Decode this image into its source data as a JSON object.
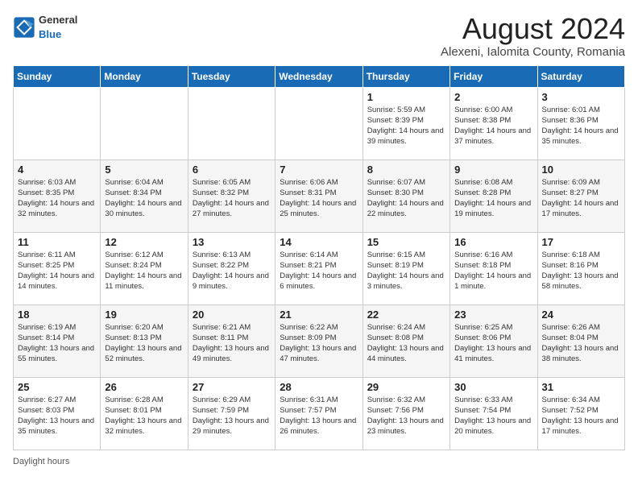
{
  "logo": {
    "general": "General",
    "blue": "Blue"
  },
  "title": {
    "month_year": "August 2024",
    "location": "Alexeni, Ialomita County, Romania"
  },
  "days_of_week": [
    "Sunday",
    "Monday",
    "Tuesday",
    "Wednesday",
    "Thursday",
    "Friday",
    "Saturday"
  ],
  "weeks": [
    [
      {
        "day": "",
        "info": ""
      },
      {
        "day": "",
        "info": ""
      },
      {
        "day": "",
        "info": ""
      },
      {
        "day": "",
        "info": ""
      },
      {
        "day": "1",
        "info": "Sunrise: 5:59 AM\nSunset: 8:39 PM\nDaylight: 14 hours and 39 minutes."
      },
      {
        "day": "2",
        "info": "Sunrise: 6:00 AM\nSunset: 8:38 PM\nDaylight: 14 hours and 37 minutes."
      },
      {
        "day": "3",
        "info": "Sunrise: 6:01 AM\nSunset: 8:36 PM\nDaylight: 14 hours and 35 minutes."
      }
    ],
    [
      {
        "day": "4",
        "info": "Sunrise: 6:03 AM\nSunset: 8:35 PM\nDaylight: 14 hours and 32 minutes."
      },
      {
        "day": "5",
        "info": "Sunrise: 6:04 AM\nSunset: 8:34 PM\nDaylight: 14 hours and 30 minutes."
      },
      {
        "day": "6",
        "info": "Sunrise: 6:05 AM\nSunset: 8:32 PM\nDaylight: 14 hours and 27 minutes."
      },
      {
        "day": "7",
        "info": "Sunrise: 6:06 AM\nSunset: 8:31 PM\nDaylight: 14 hours and 25 minutes."
      },
      {
        "day": "8",
        "info": "Sunrise: 6:07 AM\nSunset: 8:30 PM\nDaylight: 14 hours and 22 minutes."
      },
      {
        "day": "9",
        "info": "Sunrise: 6:08 AM\nSunset: 8:28 PM\nDaylight: 14 hours and 19 minutes."
      },
      {
        "day": "10",
        "info": "Sunrise: 6:09 AM\nSunset: 8:27 PM\nDaylight: 14 hours and 17 minutes."
      }
    ],
    [
      {
        "day": "11",
        "info": "Sunrise: 6:11 AM\nSunset: 8:25 PM\nDaylight: 14 hours and 14 minutes."
      },
      {
        "day": "12",
        "info": "Sunrise: 6:12 AM\nSunset: 8:24 PM\nDaylight: 14 hours and 11 minutes."
      },
      {
        "day": "13",
        "info": "Sunrise: 6:13 AM\nSunset: 8:22 PM\nDaylight: 14 hours and 9 minutes."
      },
      {
        "day": "14",
        "info": "Sunrise: 6:14 AM\nSunset: 8:21 PM\nDaylight: 14 hours and 6 minutes."
      },
      {
        "day": "15",
        "info": "Sunrise: 6:15 AM\nSunset: 8:19 PM\nDaylight: 14 hours and 3 minutes."
      },
      {
        "day": "16",
        "info": "Sunrise: 6:16 AM\nSunset: 8:18 PM\nDaylight: 14 hours and 1 minute."
      },
      {
        "day": "17",
        "info": "Sunrise: 6:18 AM\nSunset: 8:16 PM\nDaylight: 13 hours and 58 minutes."
      }
    ],
    [
      {
        "day": "18",
        "info": "Sunrise: 6:19 AM\nSunset: 8:14 PM\nDaylight: 13 hours and 55 minutes."
      },
      {
        "day": "19",
        "info": "Sunrise: 6:20 AM\nSunset: 8:13 PM\nDaylight: 13 hours and 52 minutes."
      },
      {
        "day": "20",
        "info": "Sunrise: 6:21 AM\nSunset: 8:11 PM\nDaylight: 13 hours and 49 minutes."
      },
      {
        "day": "21",
        "info": "Sunrise: 6:22 AM\nSunset: 8:09 PM\nDaylight: 13 hours and 47 minutes."
      },
      {
        "day": "22",
        "info": "Sunrise: 6:24 AM\nSunset: 8:08 PM\nDaylight: 13 hours and 44 minutes."
      },
      {
        "day": "23",
        "info": "Sunrise: 6:25 AM\nSunset: 8:06 PM\nDaylight: 13 hours and 41 minutes."
      },
      {
        "day": "24",
        "info": "Sunrise: 6:26 AM\nSunset: 8:04 PM\nDaylight: 13 hours and 38 minutes."
      }
    ],
    [
      {
        "day": "25",
        "info": "Sunrise: 6:27 AM\nSunset: 8:03 PM\nDaylight: 13 hours and 35 minutes."
      },
      {
        "day": "26",
        "info": "Sunrise: 6:28 AM\nSunset: 8:01 PM\nDaylight: 13 hours and 32 minutes."
      },
      {
        "day": "27",
        "info": "Sunrise: 6:29 AM\nSunset: 7:59 PM\nDaylight: 13 hours and 29 minutes."
      },
      {
        "day": "28",
        "info": "Sunrise: 6:31 AM\nSunset: 7:57 PM\nDaylight: 13 hours and 26 minutes."
      },
      {
        "day": "29",
        "info": "Sunrise: 6:32 AM\nSunset: 7:56 PM\nDaylight: 13 hours and 23 minutes."
      },
      {
        "day": "30",
        "info": "Sunrise: 6:33 AM\nSunset: 7:54 PM\nDaylight: 13 hours and 20 minutes."
      },
      {
        "day": "31",
        "info": "Sunrise: 6:34 AM\nSunset: 7:52 PM\nDaylight: 13 hours and 17 minutes."
      }
    ]
  ],
  "footer": {
    "daylight_label": "Daylight hours"
  }
}
